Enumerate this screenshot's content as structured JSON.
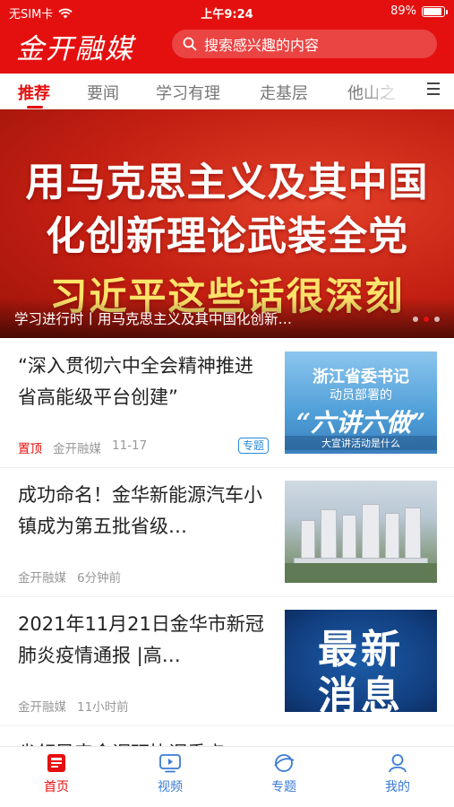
{
  "status_bar": {
    "carrier": "无SIM卡",
    "time": "上午9:24",
    "battery": "89%",
    "battery_level": 0.89
  },
  "header": {
    "brand": "金开融媒",
    "search_placeholder": "搜索感兴趣的内容"
  },
  "tabs": [
    {
      "label": "推荐",
      "active": true
    },
    {
      "label": "要闻"
    },
    {
      "label": "学习有理"
    },
    {
      "label": "走基层"
    },
    {
      "label": "他山之"
    }
  ],
  "banner": {
    "headline_1": "用马克思主义及其中国",
    "headline_2": "化创新理论武装全党",
    "headline_3": "习近平这些话很深刻",
    "caption": "学习进行时丨用马克思主义及其中国化创新…"
  },
  "news": [
    {
      "title": "“深入贯彻六中全会精神推进省高能级平台创建”",
      "pin": "置顶",
      "source": "金开融媒",
      "date": "11-17",
      "tag": "专题",
      "thumb_lines": [
        "浙江省委书记",
        "动员部署的",
        "“六讲六做”",
        "大宣讲活动是什么"
      ]
    },
    {
      "title": "成功命名！金华新能源汽车小镇成为第五批省级…",
      "source": "金开融媒",
      "date": "6分钟前"
    },
    {
      "title": "2021年11月21日金华市新冠肺炎疫情通报 |高…",
      "source": "金开融媒",
      "date": "11小时前",
      "thumb_lines": [
        "最新",
        "消息"
      ]
    },
    {
      "title": "省领导来金调研协调重点"
    }
  ],
  "bottom_nav": [
    {
      "label": "首页",
      "icon": "home-icon",
      "active": true
    },
    {
      "label": "视频",
      "icon": "video-icon"
    },
    {
      "label": "专题",
      "icon": "topic-icon"
    },
    {
      "label": "我的",
      "icon": "profile-icon"
    }
  ],
  "colors": {
    "brand_red": "#e4100f",
    "nav_blue": "#3a7bd5",
    "tag_blue": "#2a8ad6"
  }
}
